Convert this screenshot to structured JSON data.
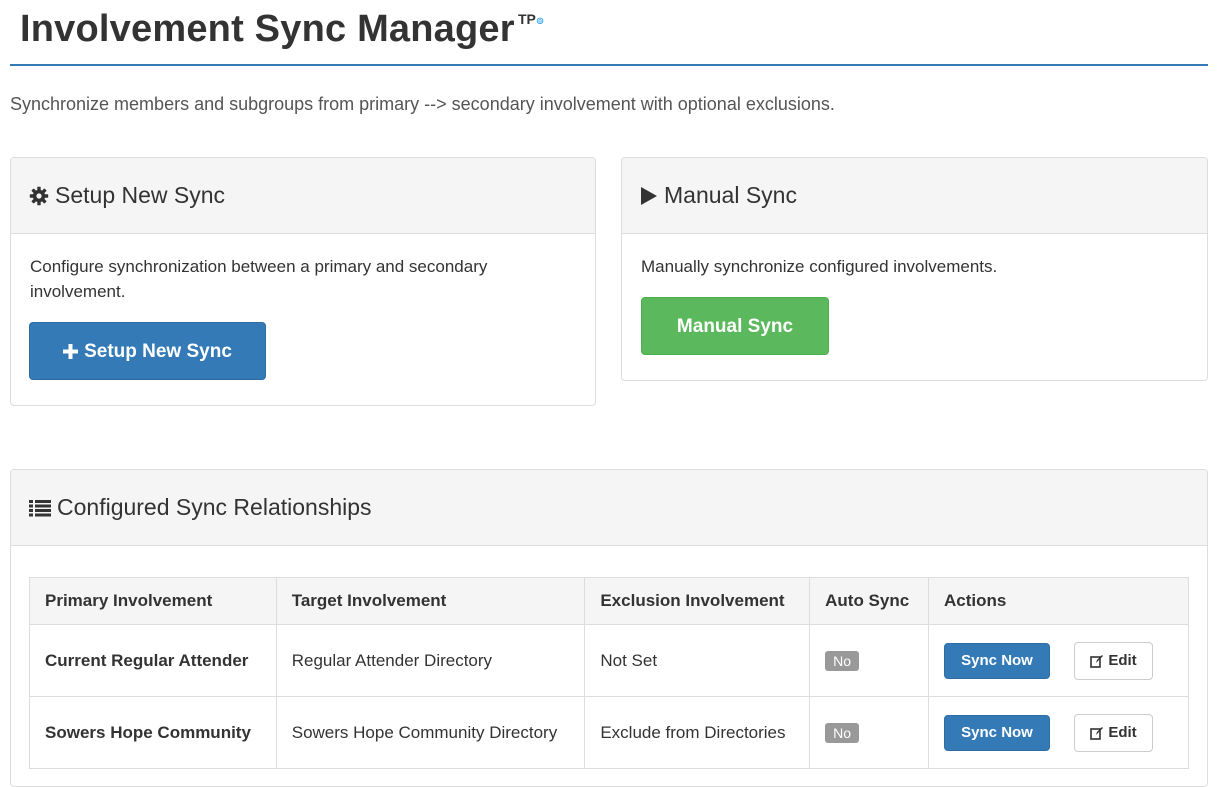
{
  "header": {
    "title": "Involvement Sync Manager",
    "badge": "TP",
    "badge_mark": "⊚"
  },
  "subtitle": "Synchronize members and subgroups from primary --> secondary involvement with optional exclusions.",
  "setup_panel": {
    "heading": "Setup New Sync",
    "icon": "gear-icon",
    "description": "Configure synchronization between a primary and secondary involvement.",
    "button_label": "Setup New Sync",
    "button_icon": "plus-icon"
  },
  "manual_panel": {
    "heading": "Manual Sync",
    "icon": "play-icon",
    "description": "Manually synchronize configured involvements.",
    "button_label": "Manual Sync"
  },
  "relationships_panel": {
    "heading": "Configured Sync Relationships",
    "icon": "list-icon",
    "columns": [
      "Primary Involvement",
      "Target Involvement",
      "Exclusion Involvement",
      "Auto Sync",
      "Actions"
    ],
    "rows": [
      {
        "primary": "Current Regular Attender",
        "target": "Regular Attender Directory",
        "exclusion": "Not Set",
        "auto_sync": "No",
        "sync_label": "Sync Now",
        "edit_label": "Edit"
      },
      {
        "primary": "Sowers Hope Community",
        "target": "Sowers Hope Community Directory",
        "exclusion": "Exclude from Directories",
        "auto_sync": "No",
        "sync_label": "Sync Now",
        "edit_label": "Edit"
      }
    ]
  },
  "colors": {
    "primary": "#337ab7",
    "success": "#5cb85c",
    "label_default": "#999999",
    "panel_heading_bg": "#f5f5f5"
  }
}
